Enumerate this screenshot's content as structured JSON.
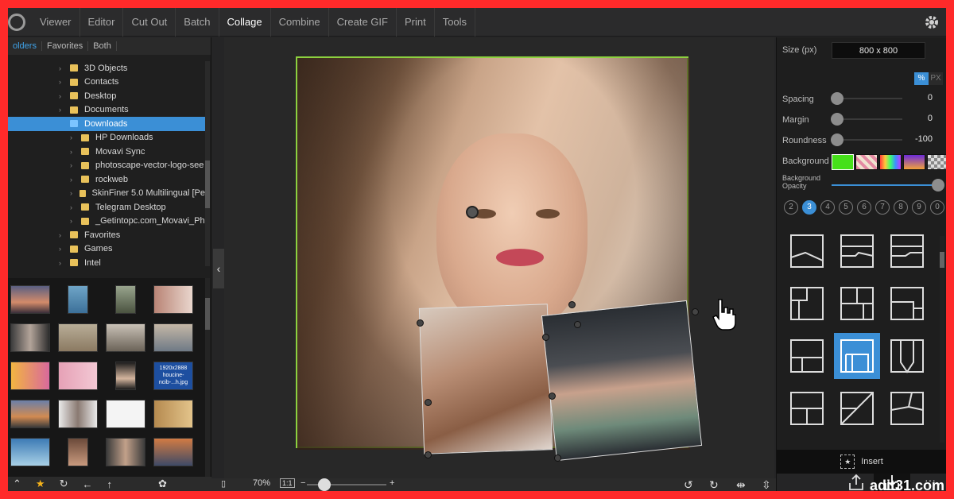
{
  "menu": {
    "items": [
      "Viewer",
      "Editor",
      "Cut Out",
      "Batch",
      "Collage",
      "Combine",
      "Create GIF",
      "Print",
      "Tools"
    ],
    "active": "Collage"
  },
  "explorer": {
    "tabs": [
      "olders",
      "Favorites",
      "Both"
    ],
    "active_tab": "olders",
    "tree": [
      {
        "label": "3D Objects",
        "indent": 0,
        "arrow": true
      },
      {
        "label": "Contacts",
        "indent": 0,
        "arrow": true
      },
      {
        "label": "Desktop",
        "indent": 0,
        "arrow": true
      },
      {
        "label": "Documents",
        "indent": 0,
        "arrow": true
      },
      {
        "label": "Downloads",
        "indent": 0,
        "arrow": false,
        "selected": true
      },
      {
        "label": "HP Downloads",
        "indent": 1,
        "arrow": true
      },
      {
        "label": "Movavi Sync",
        "indent": 1,
        "arrow": true
      },
      {
        "label": "photoscape-vector-logo-see",
        "indent": 1,
        "arrow": true
      },
      {
        "label": "rockweb",
        "indent": 1,
        "arrow": true
      },
      {
        "label": "SkinFiner 5.0 Multilingual [Pe",
        "indent": 1,
        "arrow": true
      },
      {
        "label": "Telegram Desktop",
        "indent": 1,
        "arrow": true
      },
      {
        "label": "_Getintopc.com_Movavi_Ph",
        "indent": 1,
        "arrow": true
      },
      {
        "label": "Favorites",
        "indent": 0,
        "arrow": true
      },
      {
        "label": "Games",
        "indent": 0,
        "arrow": true
      },
      {
        "label": "Intel",
        "indent": 0,
        "arrow": true
      }
    ],
    "thumb_selected_caption_1": "1920x2888",
    "thumb_selected_caption_2": "houcine-",
    "thumb_selected_caption_3": "ncib-...h.jpg"
  },
  "canvas": {
    "zoom": "70%",
    "one_to_one": "1:1",
    "zoom_minus": "−",
    "zoom_plus": "+",
    "zoom_level": 0.22
  },
  "panel": {
    "size_label": "Size (px)",
    "size_value": "800 x 800",
    "unit_percent": "%",
    "unit_px": "PX",
    "spacing_label": "Spacing",
    "spacing_value": "0",
    "margin_label": "Margin",
    "margin_value": "0",
    "roundness_label": "Roundness",
    "roundness_value": "-100",
    "background_label": "Background",
    "bg_opacity_label_1": "Background",
    "bg_opacity_label_2": "Opacity",
    "bg_opacity_level": 1.0,
    "counts": [
      "2",
      "3",
      "4",
      "5",
      "6",
      "7",
      "8",
      "9",
      "0"
    ],
    "selected_count": "3",
    "insert_label": "Insert",
    "more": "···"
  },
  "colors": {
    "accent": "#3b8fd6",
    "selection_border": "#8cd13f",
    "swatch_green": "#46e01a"
  },
  "watermark": "adit31.com"
}
